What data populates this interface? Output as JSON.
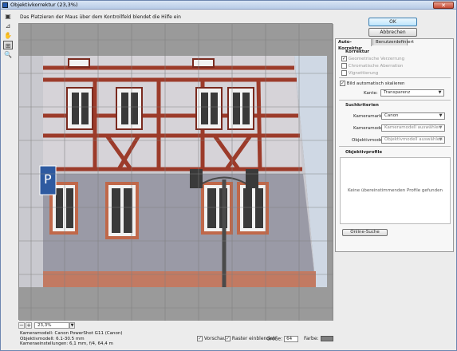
{
  "window": {
    "title": "Objektivkorrektur (23,3%)"
  },
  "toolbar": {
    "hint": "Das Platzieren der Maus über dem Kontrollfeld blendet die Hilfe ein",
    "tools": [
      "remove-distortion-tool-icon",
      "straighten-tool-icon",
      "move-grid-tool-icon",
      "hand-tool-icon",
      "zoom-tool-icon"
    ]
  },
  "buttons": {
    "ok": "OK",
    "cancel": "Abbrechen",
    "online_search": "Online-Suche"
  },
  "tabs": {
    "auto": "Auto-Korrektur",
    "custom": "Benutzerdefiniert"
  },
  "correction": {
    "section": "Korrektur",
    "geometric": "Geometrische Verzerrung",
    "chromatic": "Chromatische Aberration",
    "vignette": "Vignettierung",
    "autoscale": "Bild automatisch skalieren",
    "edge_label": "Kante:",
    "edge_value": "Transparenz"
  },
  "search": {
    "section": "Suchkriterien",
    "make_label": "Kameramarke:",
    "make_value": "Canon",
    "model_label": "Kameramodell:",
    "model_value": "Kameramodell auswählen",
    "lens_label": "Objektivmodell:",
    "lens_value": "Objektivmodell auswählen"
  },
  "profiles": {
    "section": "Objektivprofile",
    "empty": "Keine übereinstimmenden Profile gefunden"
  },
  "zoom": {
    "minus": "−",
    "plus": "+",
    "value": "23,3%"
  },
  "info": {
    "camera": "Kameramodell: Canon PowerShot G11 (Canon)",
    "lens": "Objektivmodell: 6.1-30.5 mm",
    "settings": "Kameraeinstellungen: 6,1 mm, f/4, 64,4 m"
  },
  "options": {
    "preview": "Vorschau",
    "grid": "Raster einblenden",
    "size_label": "Größe:",
    "size_value": "64",
    "color_label": "Farbe:"
  },
  "colors": {
    "accent": "#3c7fb1",
    "grid_color": "#7f7f7f"
  }
}
